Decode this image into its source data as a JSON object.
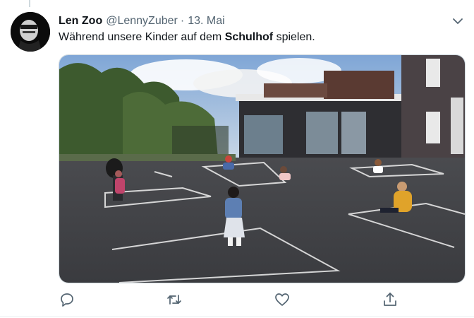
{
  "tweet": {
    "author_name": "Len Zoo",
    "author_handle": "@LennyZuber",
    "separator": "·",
    "date": "13. Mai",
    "text_before": "Während unsere Kinder auf dem ",
    "text_bold": "Schulhof",
    "text_after": " spielen."
  },
  "icons": {
    "menu": "chevron-down-icon",
    "reply": "speech-bubble-icon",
    "retweet": "retweet-icon",
    "like": "heart-icon",
    "share": "share-icon"
  },
  "colors": {
    "text": "#0f1419",
    "secondary": "#536471",
    "icon": "#536471",
    "border": "#cfd9de"
  }
}
